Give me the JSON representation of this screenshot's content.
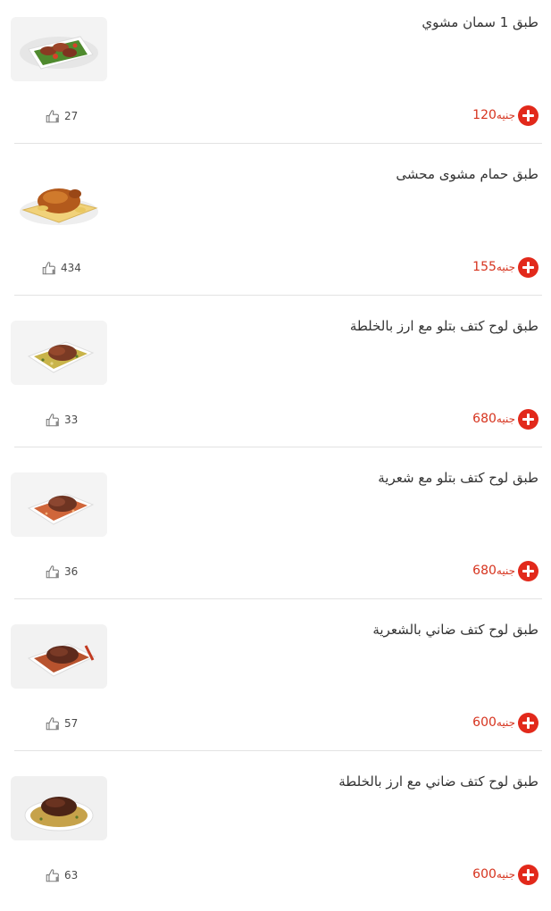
{
  "items": [
    {
      "title": "طبق 1 سمان مشوي",
      "price": "120",
      "currency": "جنيه",
      "likes": "27",
      "image": "grilled-quail-platter"
    },
    {
      "title": "طبق حمام مشوى محشى",
      "price": "155",
      "currency": "جنيه",
      "likes": "434",
      "image": "stuffed-pigeon"
    },
    {
      "title": "طبق لوح كتف بتلو مع ارز بالخلطة",
      "price": "680",
      "currency": "جنيه",
      "likes": "33",
      "image": "veal-shoulder-rice"
    },
    {
      "title": "طبق لوح كتف بتلو مع شعرية",
      "price": "680",
      "currency": "جنيه",
      "likes": "36",
      "image": "veal-shoulder-vermicelli"
    },
    {
      "title": "طبق لوح كتف ضاني بالشعرية",
      "price": "600",
      "currency": "جنيه",
      "likes": "57",
      "image": "lamb-shoulder-vermicelli"
    },
    {
      "title": "طبق لوح كتف ضاني مع ارز بالخلطة",
      "price": "600",
      "currency": "جنيه",
      "likes": "63",
      "image": "lamb-shoulder-rice"
    }
  ],
  "colors": {
    "accent": "#e2291b",
    "price": "#d6331e",
    "title": "#333333",
    "divider": "#e3e3e3"
  },
  "icons": {
    "add": "plus-circle-icon",
    "like": "thumbs-up-icon"
  }
}
